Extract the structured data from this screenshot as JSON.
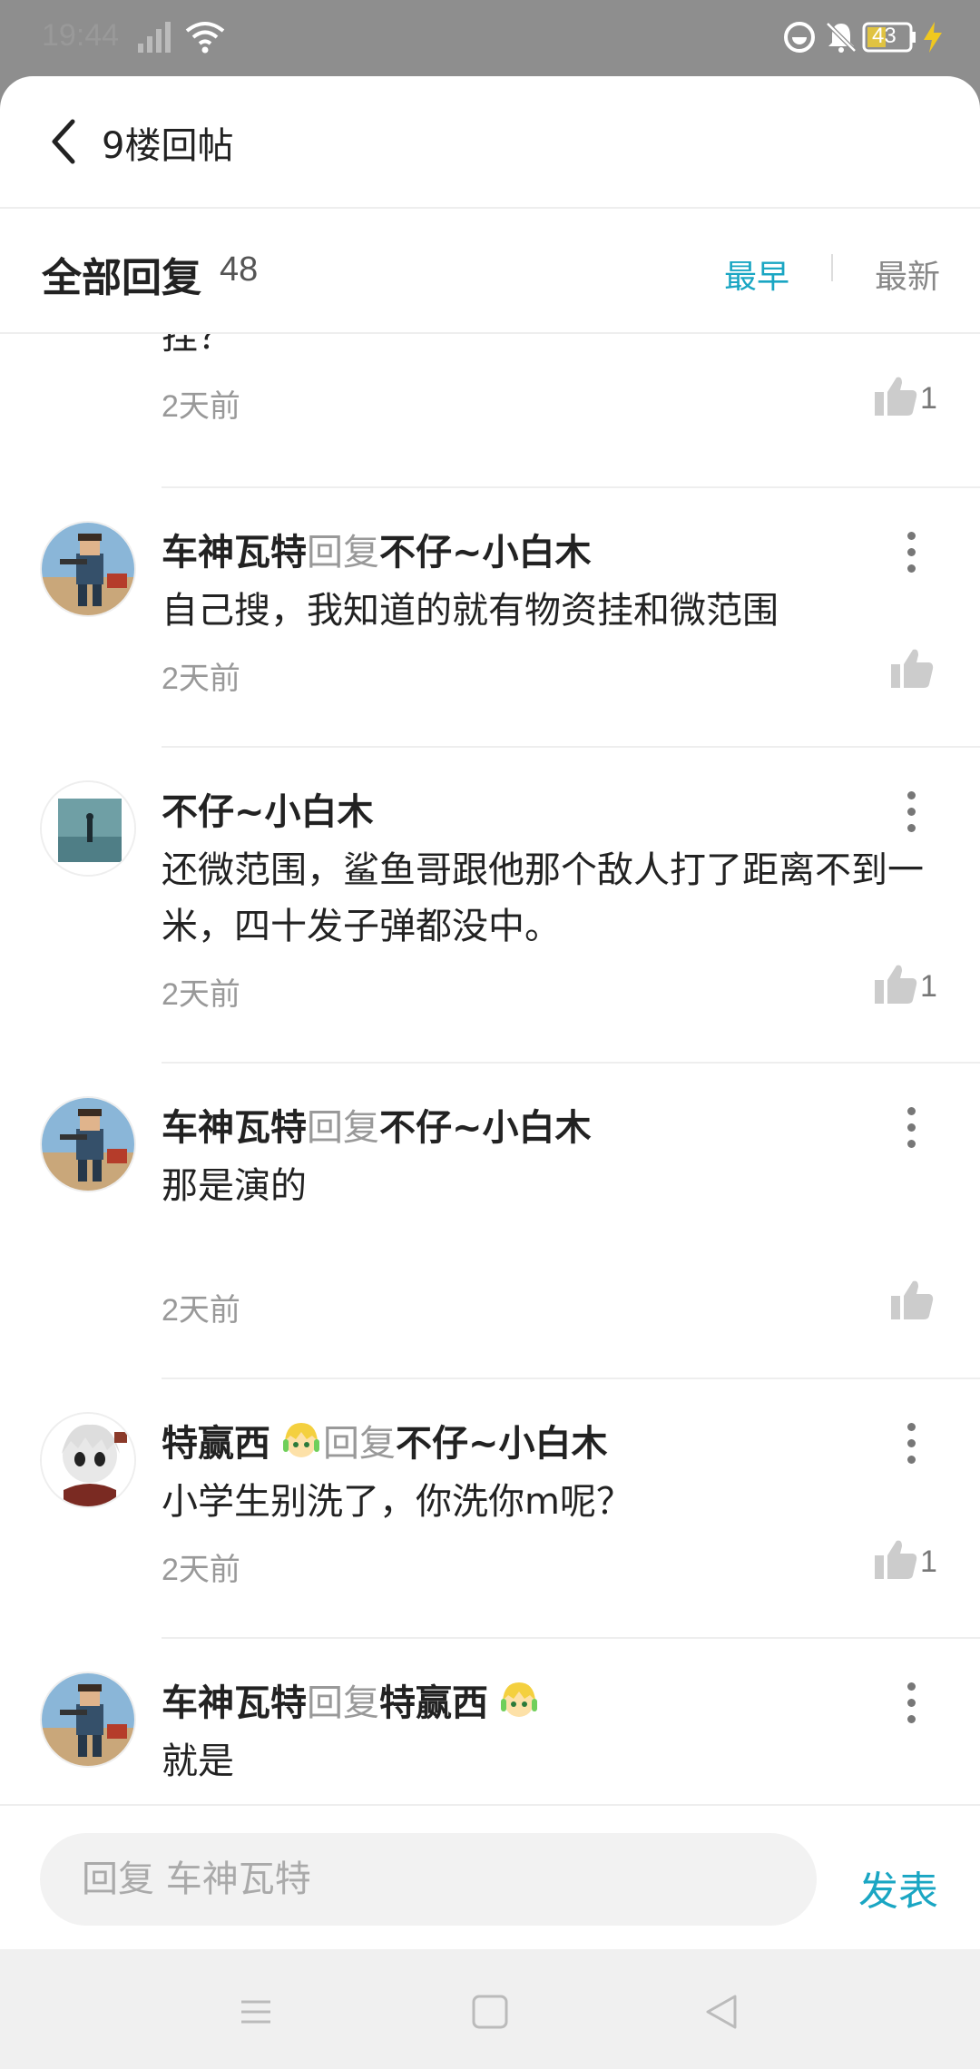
{
  "status_bar": {
    "time": "19:44",
    "battery": "43"
  },
  "header": {
    "title": "9楼回帖"
  },
  "filter": {
    "heading": "全部回复",
    "count": "48",
    "earliest": "最早",
    "latest": "最新"
  },
  "partial": {
    "content_tail": "挂？",
    "time": "2天前",
    "likes": "1"
  },
  "replies": [
    {
      "author": "车神瓦特",
      "reply_word": "回复",
      "target": "不仔~小白木",
      "content": "自己搜，我知道的就有物资挂和微范围",
      "time": "2天前",
      "likes": ""
    },
    {
      "author": "不仔~小白木",
      "reply_word": "",
      "target": "",
      "content": "还微范围，鲨鱼哥跟他那个敌人打了距离不到一米，四十发子弹都没中。",
      "time": "2天前",
      "likes": "1"
    },
    {
      "author": "车神瓦特",
      "reply_word": "回复",
      "target": "不仔~小白木",
      "content": "那是演的",
      "time": "2天前",
      "likes": ""
    },
    {
      "author": "特赢西",
      "reply_word": "回复",
      "target": "不仔~小白木",
      "content": "小学生别洗了，你洗你m呢？",
      "time": "2天前",
      "likes": "1"
    },
    {
      "author": "车神瓦特",
      "reply_word": "回复",
      "target": "特赢西",
      "content": "就是",
      "time": "",
      "likes": ""
    }
  ],
  "composer": {
    "placeholder": "回复 车神瓦特",
    "send_label": "发表"
  },
  "colors": {
    "accent": "#1aa6c3",
    "status_bar": "#8e8e8e"
  }
}
